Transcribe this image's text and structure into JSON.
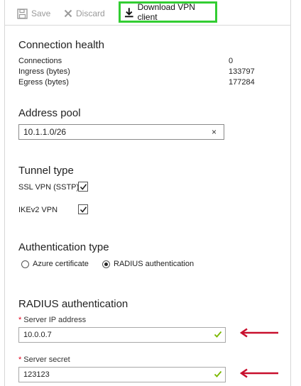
{
  "toolbar": {
    "save_label": "Save",
    "discard_label": "Discard",
    "download_label": "Download VPN client"
  },
  "connection_health": {
    "title": "Connection health",
    "rows": [
      {
        "label": "Connections",
        "value": "0"
      },
      {
        "label": "Ingress (bytes)",
        "value": "133797"
      },
      {
        "label": "Egress (bytes)",
        "value": "177284"
      }
    ]
  },
  "address_pool": {
    "title": "Address pool",
    "value": "10.1.1.0/26",
    "clear_glyph": "×"
  },
  "tunnel_type": {
    "title": "Tunnel type",
    "options": [
      {
        "label": "SSL VPN (SSTP)",
        "checked": true
      },
      {
        "label": "IKEv2 VPN",
        "checked": true
      }
    ]
  },
  "authentication_type": {
    "title": "Authentication type",
    "options": [
      {
        "label": "Azure certificate",
        "selected": false
      },
      {
        "label": "RADIUS authentication",
        "selected": true
      }
    ]
  },
  "radius": {
    "title": "RADIUS authentication",
    "server_ip": {
      "label": "Server IP address",
      "value": "10.0.0.7"
    },
    "server_secret": {
      "label": "Server secret",
      "value": "123123"
    },
    "required_glyph": "*"
  },
  "colors": {
    "highlight": "#32cd32",
    "valid_check": "#7ab800",
    "arrow": "#c8102e",
    "required": "#e0001b"
  },
  "icons": [
    "save-icon",
    "discard-icon",
    "download-icon",
    "clear-icon",
    "checkmark-icon",
    "arrow-left-icon"
  ]
}
